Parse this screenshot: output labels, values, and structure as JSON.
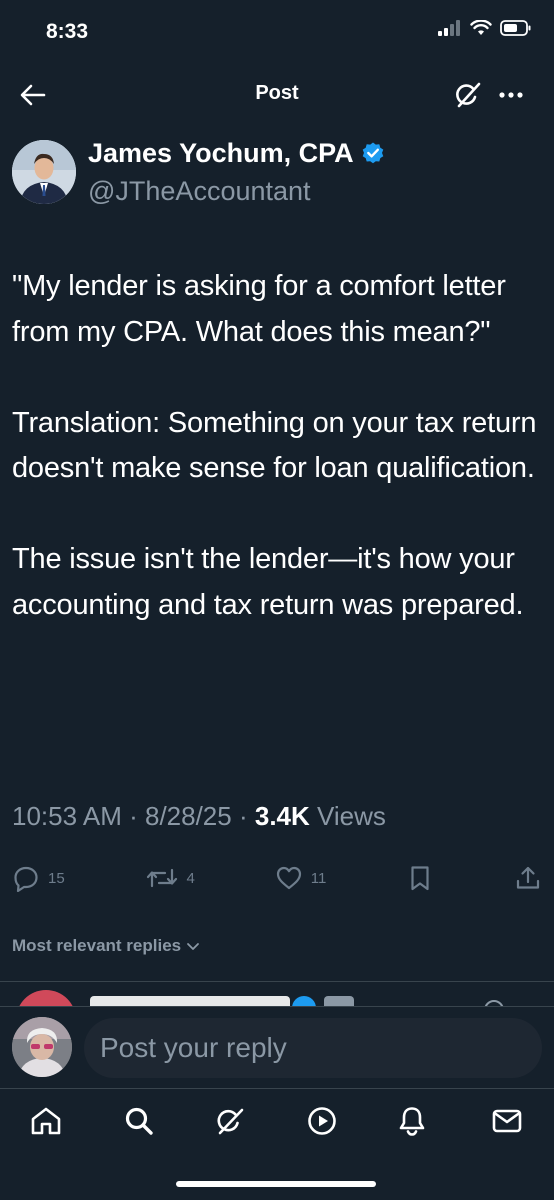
{
  "status_bar": {
    "time": "8:33"
  },
  "nav": {
    "title": "Post"
  },
  "author": {
    "name": "James Yochum, CPA",
    "handle": "@JTheAccountant",
    "verified": true
  },
  "tweet": {
    "text": "\"My lender is asking for a comfort letter from my CPA. What does this mean?\"\n\nTranslation: Something on your tax return doesn't make sense for loan qualification.\n\nThe issue isn't the lender—it's how your accounting and tax return was prepared.",
    "time": "10:53 AM",
    "date": "8/28/25",
    "views_count": "3.4K",
    "views_label": "Views"
  },
  "actions": {
    "replies": "15",
    "reposts": "4",
    "likes": "11"
  },
  "replies_section": {
    "label": "Most relevant replies"
  },
  "composer": {
    "placeholder": "Post your reply"
  },
  "icons": {
    "back": "arrow-left-icon",
    "grok": "grok-icon",
    "more": "more-icon",
    "reply": "reply-icon",
    "repost": "repost-icon",
    "like": "heart-icon",
    "bookmark": "bookmark-icon",
    "share": "share-icon",
    "tabs": [
      "home-icon",
      "search-icon",
      "grok-icon",
      "video-icon",
      "notifications-icon",
      "messages-icon"
    ]
  },
  "colors": {
    "background": "#15202b",
    "secondary_text": "#8b98a5",
    "verified": "#1d9bf0",
    "divider": "#38444d"
  }
}
